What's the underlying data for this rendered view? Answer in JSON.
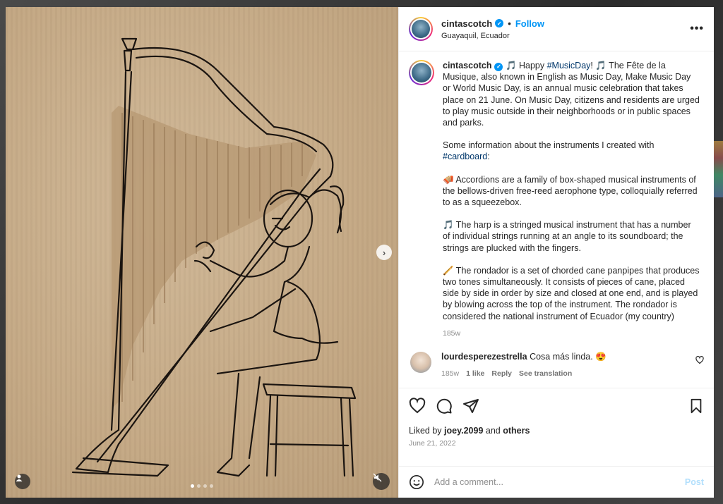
{
  "post": {
    "username": "cintascotch",
    "follow_sep": "•",
    "follow_label": "Follow",
    "location": "Guayaquil, Ecuador",
    "more_icon": "•••"
  },
  "caption": {
    "username": "cintascotch",
    "line1_pre": " 🎵 Happy ",
    "hashtag_music": "#MusicDay",
    "line1_post": "! 🎵 The Fête de la Musique, also known in English as Music Day, Make Music Day or World Music Day, is an annual music celebration that takes place on 21 June. On Music Day, citizens and residents are urged to play music outside in their neighborhoods or in public spaces and parks.",
    "para2_pre": "Some information about the instruments I created with ",
    "hashtag_cardboard": "#cardboard",
    "para2_post": ":",
    "para3": "🪗 Accordions are a family of box-shaped musical instruments of the bellows-driven free-reed aerophone type, colloquially referred to as a squeezebox.",
    "para4": "🎵 The harp is a stringed musical instrument that has a number of individual strings running at an angle to its soundboard; the strings are plucked with the fingers.",
    "para5": "🪈 The rondador is a set of chorded cane panpipes that produces two tones simultaneously. It consists of pieces of cane, placed side by side in order by size and closed at one end, and is played by blowing across the top of the instrument. The rondador is considered the national instrument of Ecuador (my country)",
    "timestamp": "185w"
  },
  "comment": {
    "username": "lourdesperezestrella",
    "text": " Cosa más linda. 😍",
    "timestamp": "185w",
    "likes": "1 like",
    "reply": "Reply",
    "translate": "See translation"
  },
  "actions": {
    "liked_pre": "Liked by ",
    "liked_user": "joey.2099",
    "liked_mid": " and ",
    "liked_others": "others",
    "date": "June 21, 2022"
  },
  "composer": {
    "placeholder": "Add a comment...",
    "post_label": "Post"
  },
  "media": {
    "next_icon": "›",
    "slide_count": 4,
    "active_slide": 1
  }
}
